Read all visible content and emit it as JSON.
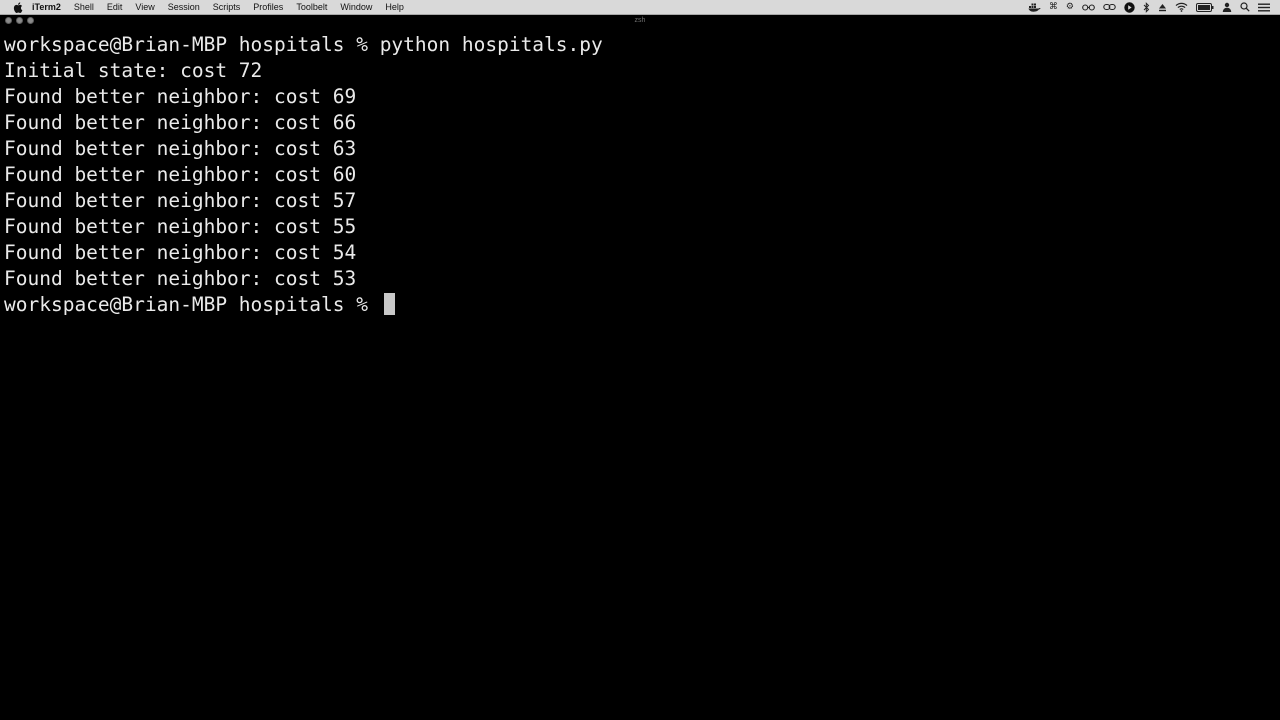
{
  "menubar": {
    "app_name": "iTerm2",
    "items": [
      "Shell",
      "Edit",
      "View",
      "Session",
      "Scripts",
      "Profiles",
      "Toolbelt",
      "Window",
      "Help"
    ]
  },
  "window": {
    "title": "zsh"
  },
  "terminal": {
    "prompt": "workspace@Brian-MBP hospitals % ",
    "command": "python hospitals.py",
    "output": [
      "Initial state: cost 72",
      "Found better neighbor: cost 69",
      "Found better neighbor: cost 66",
      "Found better neighbor: cost 63",
      "Found better neighbor: cost 60",
      "Found better neighbor: cost 57",
      "Found better neighbor: cost 55",
      "Found better neighbor: cost 54",
      "Found better neighbor: cost 53"
    ],
    "final_prompt": "workspace@Brian-MBP hospitals % "
  },
  "colors": {
    "terminal_bg": "#000000",
    "terminal_fg": "#eaeaea",
    "menubar_bg": "#d9d9d9"
  }
}
